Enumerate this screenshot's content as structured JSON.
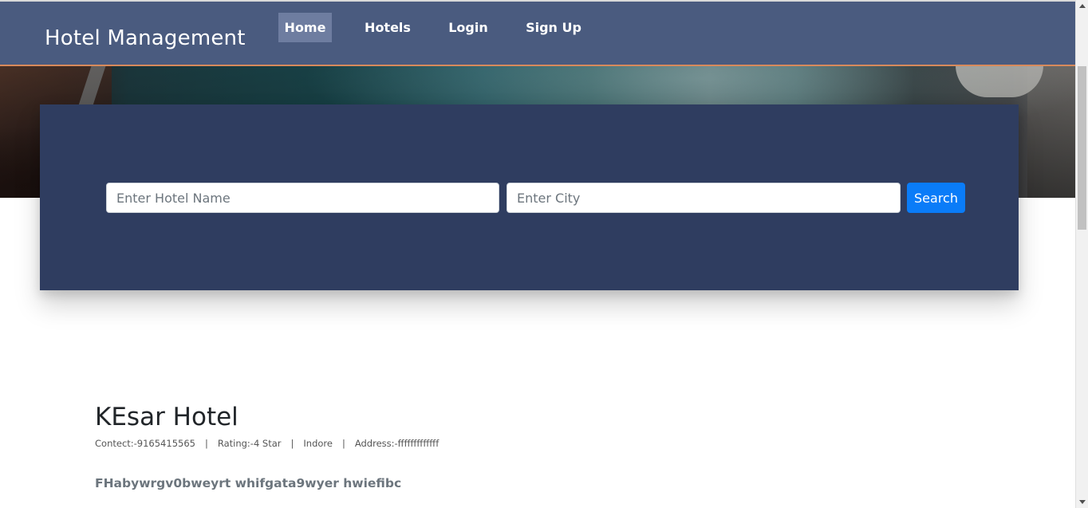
{
  "navbar": {
    "brand": "Hotel Management",
    "items": [
      {
        "label": "Home",
        "active": true
      },
      {
        "label": "Hotels"
      },
      {
        "label": "Login"
      },
      {
        "label": "Sign Up"
      }
    ]
  },
  "search": {
    "hotel_placeholder": "Enter Hotel Name",
    "city_placeholder": "Enter City",
    "button_label": "Search"
  },
  "hotel": {
    "name": "KEsar Hotel",
    "contact": "Contect:-9165415565",
    "rating": "Rating:-4 Star",
    "city": "Indore",
    "address": "Address:-fffffffffffff",
    "separator": "|",
    "description": "FHabywrgv0bweyrt whifgata9wyer hwiefibc"
  },
  "colors": {
    "navbar_bg": "#4a5b7f",
    "nav_active_bg": "#6e7da0",
    "panel_bg": "#2f3d60",
    "search_button": "#0a7cf8",
    "navbar_border": "#d88a5c"
  },
  "icons": {
    "scroll_up": "triangle-up",
    "scroll_down": "triangle-down"
  }
}
